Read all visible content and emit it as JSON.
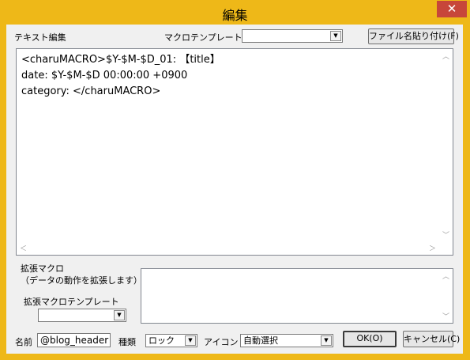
{
  "window": {
    "title": "編集",
    "close_label": "✕"
  },
  "toolbar": {
    "text_edit_label": "テキスト編集",
    "macro_template_label": "マクロテンプレート",
    "macro_template_value": "",
    "paste_filename_button": "ファイル名貼り付け(F)"
  },
  "editor": {
    "content": "<charuMACRO>$Y-$M-$D_01: 【title】\ndate: $Y-$M-$D 00:00:00 +0900\ncategory: </charuMACRO>"
  },
  "extended_macro": {
    "label": "拡張マクロ\n（データの動作を拡張します）",
    "template_label": "拡張マクロテンプレート",
    "template_value": "",
    "content": ""
  },
  "bottom": {
    "name_label": "名前",
    "name_value": "@blog_header",
    "type_label": "種類",
    "type_value": "ロック",
    "icon_label": "アイコン",
    "icon_value": "自動選択",
    "ok_button": "OK(O)",
    "cancel_button": "キャンセル(C)"
  }
}
